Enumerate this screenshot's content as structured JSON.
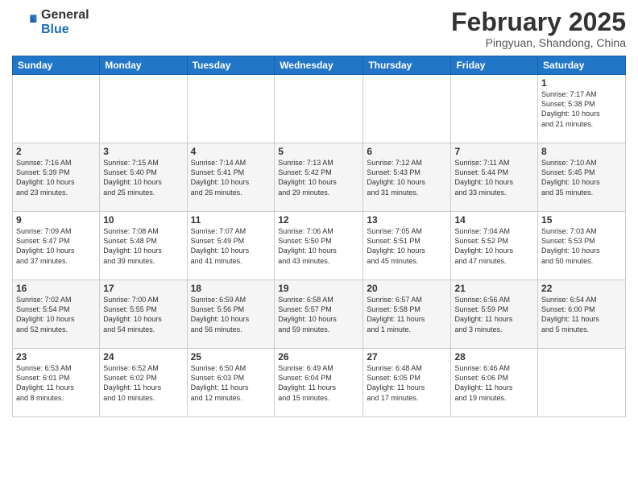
{
  "logo": {
    "general": "General",
    "blue": "Blue"
  },
  "header": {
    "month": "February 2025",
    "location": "Pingyuan, Shandong, China"
  },
  "weekdays": [
    "Sunday",
    "Monday",
    "Tuesday",
    "Wednesday",
    "Thursday",
    "Friday",
    "Saturday"
  ],
  "weeks": [
    [
      {
        "day": "",
        "info": ""
      },
      {
        "day": "",
        "info": ""
      },
      {
        "day": "",
        "info": ""
      },
      {
        "day": "",
        "info": ""
      },
      {
        "day": "",
        "info": ""
      },
      {
        "day": "",
        "info": ""
      },
      {
        "day": "1",
        "info": "Sunrise: 7:17 AM\nSunset: 5:38 PM\nDaylight: 10 hours\nand 21 minutes."
      }
    ],
    [
      {
        "day": "2",
        "info": "Sunrise: 7:16 AM\nSunset: 5:39 PM\nDaylight: 10 hours\nand 23 minutes."
      },
      {
        "day": "3",
        "info": "Sunrise: 7:15 AM\nSunset: 5:40 PM\nDaylight: 10 hours\nand 25 minutes."
      },
      {
        "day": "4",
        "info": "Sunrise: 7:14 AM\nSunset: 5:41 PM\nDaylight: 10 hours\nand 26 minutes."
      },
      {
        "day": "5",
        "info": "Sunrise: 7:13 AM\nSunset: 5:42 PM\nDaylight: 10 hours\nand 29 minutes."
      },
      {
        "day": "6",
        "info": "Sunrise: 7:12 AM\nSunset: 5:43 PM\nDaylight: 10 hours\nand 31 minutes."
      },
      {
        "day": "7",
        "info": "Sunrise: 7:11 AM\nSunset: 5:44 PM\nDaylight: 10 hours\nand 33 minutes."
      },
      {
        "day": "8",
        "info": "Sunrise: 7:10 AM\nSunset: 5:45 PM\nDaylight: 10 hours\nand 35 minutes."
      }
    ],
    [
      {
        "day": "9",
        "info": "Sunrise: 7:09 AM\nSunset: 5:47 PM\nDaylight: 10 hours\nand 37 minutes."
      },
      {
        "day": "10",
        "info": "Sunrise: 7:08 AM\nSunset: 5:48 PM\nDaylight: 10 hours\nand 39 minutes."
      },
      {
        "day": "11",
        "info": "Sunrise: 7:07 AM\nSunset: 5:49 PM\nDaylight: 10 hours\nand 41 minutes."
      },
      {
        "day": "12",
        "info": "Sunrise: 7:06 AM\nSunset: 5:50 PM\nDaylight: 10 hours\nand 43 minutes."
      },
      {
        "day": "13",
        "info": "Sunrise: 7:05 AM\nSunset: 5:51 PM\nDaylight: 10 hours\nand 45 minutes."
      },
      {
        "day": "14",
        "info": "Sunrise: 7:04 AM\nSunset: 5:52 PM\nDaylight: 10 hours\nand 47 minutes."
      },
      {
        "day": "15",
        "info": "Sunrise: 7:03 AM\nSunset: 5:53 PM\nDaylight: 10 hours\nand 50 minutes."
      }
    ],
    [
      {
        "day": "16",
        "info": "Sunrise: 7:02 AM\nSunset: 5:54 PM\nDaylight: 10 hours\nand 52 minutes."
      },
      {
        "day": "17",
        "info": "Sunrise: 7:00 AM\nSunset: 5:55 PM\nDaylight: 10 hours\nand 54 minutes."
      },
      {
        "day": "18",
        "info": "Sunrise: 6:59 AM\nSunset: 5:56 PM\nDaylight: 10 hours\nand 56 minutes."
      },
      {
        "day": "19",
        "info": "Sunrise: 6:58 AM\nSunset: 5:57 PM\nDaylight: 10 hours\nand 59 minutes."
      },
      {
        "day": "20",
        "info": "Sunrise: 6:57 AM\nSunset: 5:58 PM\nDaylight: 11 hours\nand 1 minute."
      },
      {
        "day": "21",
        "info": "Sunrise: 6:56 AM\nSunset: 5:59 PM\nDaylight: 11 hours\nand 3 minutes."
      },
      {
        "day": "22",
        "info": "Sunrise: 6:54 AM\nSunset: 6:00 PM\nDaylight: 11 hours\nand 5 minutes."
      }
    ],
    [
      {
        "day": "23",
        "info": "Sunrise: 6:53 AM\nSunset: 6:01 PM\nDaylight: 11 hours\nand 8 minutes."
      },
      {
        "day": "24",
        "info": "Sunrise: 6:52 AM\nSunset: 6:02 PM\nDaylight: 11 hours\nand 10 minutes."
      },
      {
        "day": "25",
        "info": "Sunrise: 6:50 AM\nSunset: 6:03 PM\nDaylight: 11 hours\nand 12 minutes."
      },
      {
        "day": "26",
        "info": "Sunrise: 6:49 AM\nSunset: 6:04 PM\nDaylight: 11 hours\nand 15 minutes."
      },
      {
        "day": "27",
        "info": "Sunrise: 6:48 AM\nSunset: 6:05 PM\nDaylight: 11 hours\nand 17 minutes."
      },
      {
        "day": "28",
        "info": "Sunrise: 6:46 AM\nSunset: 6:06 PM\nDaylight: 11 hours\nand 19 minutes."
      },
      {
        "day": "",
        "info": ""
      }
    ]
  ]
}
